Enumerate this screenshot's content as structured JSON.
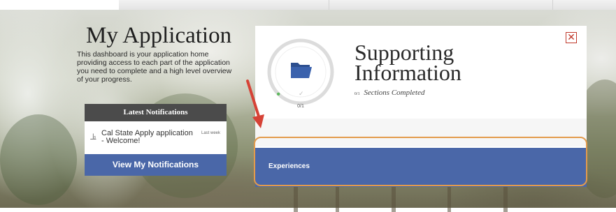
{
  "intro": {
    "title": "My Application",
    "description": "This dashboard is your application home providing access to each part of the application you need to complete and a high level overview of your progress."
  },
  "notifications": {
    "header": "Latest Notifications",
    "items": [
      {
        "text": "Cal State Apply application - Welcome!",
        "time": "Last week",
        "icon": "bell-icon"
      }
    ],
    "view_button": "View My Notifications"
  },
  "section": {
    "title_line1": "Supporting",
    "title_line2": "Information",
    "completed_count": "0/1",
    "completed_label": "Sections Completed",
    "progress_label": "0/1",
    "progress_fraction": 0,
    "icon": "folder-icon",
    "close_icon": "close-icon"
  },
  "subsections": [
    {
      "label": "Experiences"
    }
  ],
  "colors": {
    "primary_blue": "#4a67a8",
    "notification_header": "#4b4b4b",
    "highlight_orange": "#e39b4c",
    "annotation_red": "#d64236",
    "close_red": "#c0392b",
    "progress_green": "#5cb85c"
  }
}
